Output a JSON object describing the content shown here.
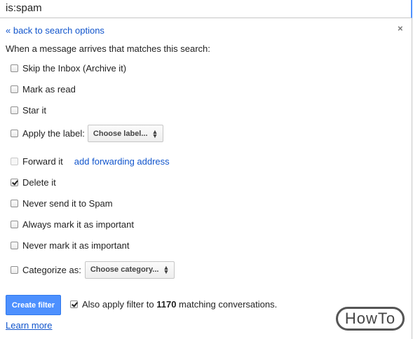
{
  "search": {
    "query": "is:spam"
  },
  "panel": {
    "close_label": "×",
    "back_link": "« back to search options",
    "intro": "When a message arrives that matches this search:"
  },
  "options": [
    {
      "label": "Skip the Inbox (Archive it)",
      "checked": false
    },
    {
      "label": "Mark as read",
      "checked": false
    },
    {
      "label": "Star it",
      "checked": false
    },
    {
      "label": "Apply the label:",
      "checked": false,
      "select": "Choose label..."
    },
    {
      "label": "Forward it",
      "checked": false,
      "disabled": true,
      "link": "add forwarding address"
    },
    {
      "label": "Delete it",
      "checked": true
    },
    {
      "label": "Never send it to Spam",
      "checked": false
    },
    {
      "label": "Always mark it as important",
      "checked": false
    },
    {
      "label": "Never mark it as important",
      "checked": false
    },
    {
      "label": "Categorize as:",
      "checked": false,
      "select": "Choose category..."
    }
  ],
  "footer": {
    "create_button": "Create filter",
    "also_apply_prefix": "Also apply filter to ",
    "match_count": "1170",
    "also_apply_suffix": " matching conversations.",
    "also_apply_checked": true,
    "learn_more": "Learn more"
  },
  "watermark": "HowTo",
  "colors": {
    "accent": "#4d90fe",
    "link": "#1155cc"
  }
}
